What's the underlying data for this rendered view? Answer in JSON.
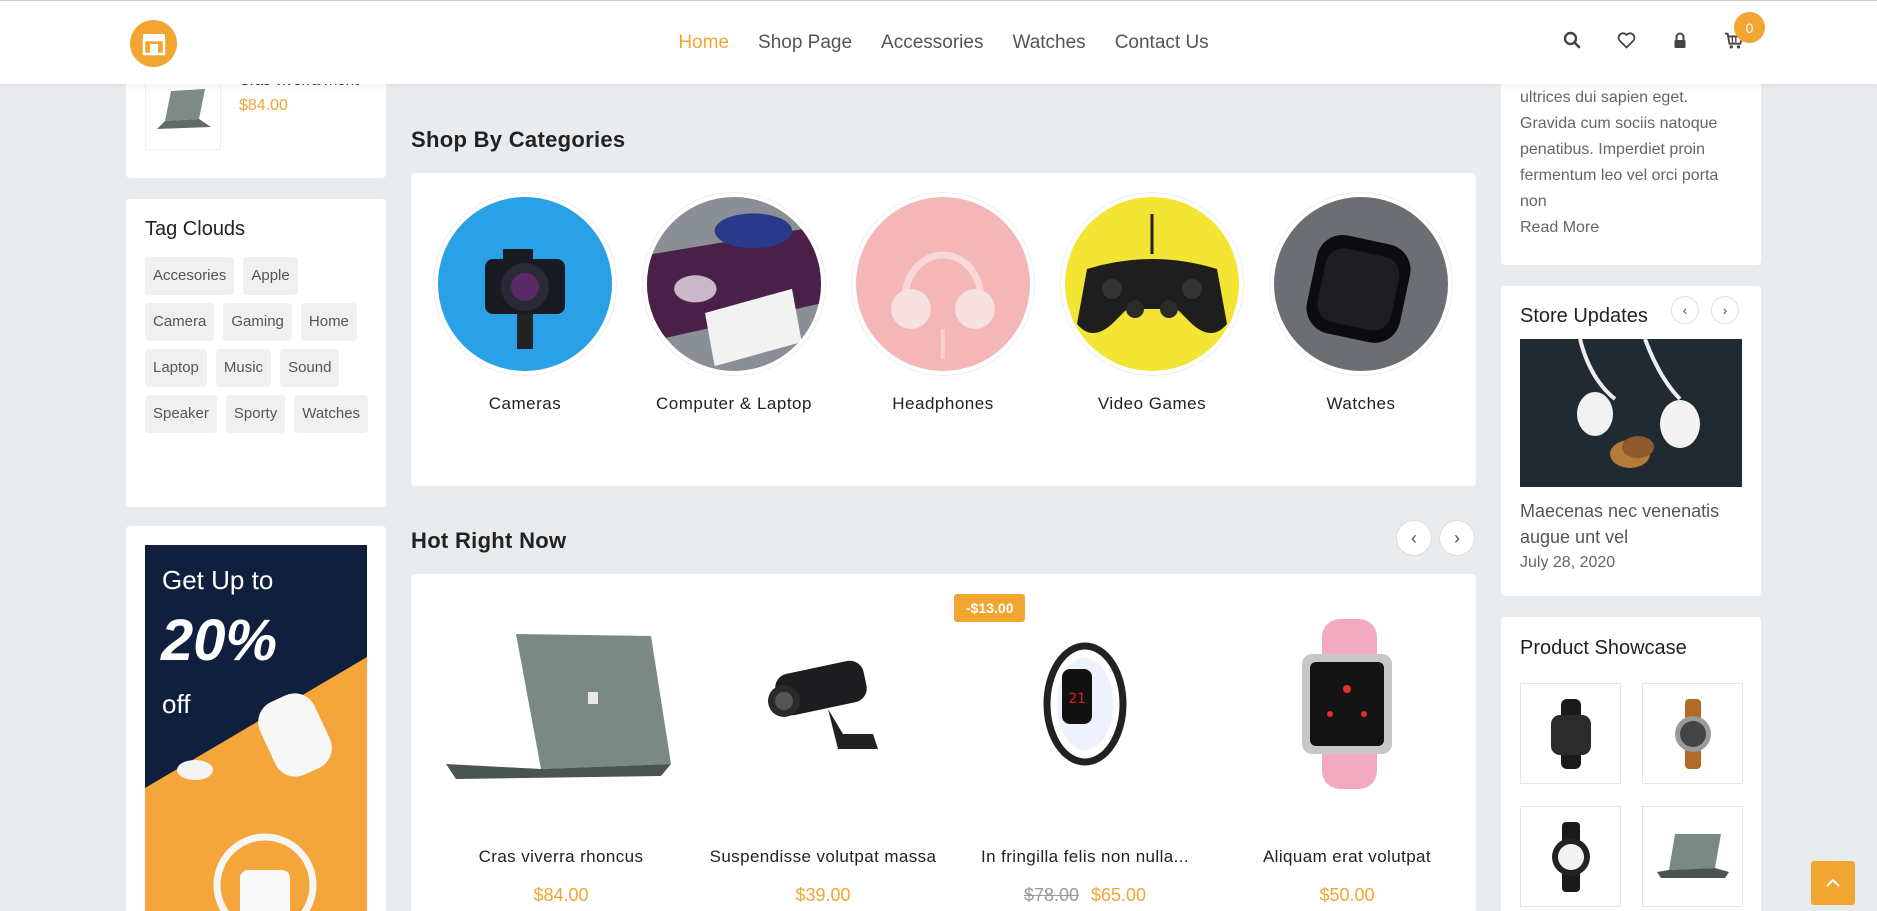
{
  "header": {
    "nav": [
      "Home",
      "Shop Page",
      "Accessories",
      "Watches",
      "Contact Us"
    ],
    "cart_count": "0"
  },
  "left": {
    "product": {
      "name": "Cras viverra rhoncus",
      "price": "$84.00"
    },
    "tags_title": "Tag Clouds",
    "tags": [
      "Accesories",
      "Apple",
      "Camera",
      "Gaming",
      "Home",
      "Laptop",
      "Music",
      "Sound",
      "Speaker",
      "Sporty",
      "Watches"
    ],
    "banner": {
      "line1": "Get Up to",
      "line2": "20%",
      "line3": "off"
    }
  },
  "categories": {
    "title": "Shop By Categories",
    "items": [
      "Cameras",
      "Computer & Laptop",
      "Headphones",
      "Video Games",
      "Watches"
    ]
  },
  "hot": {
    "title": "Hot Right Now",
    "badge": "-$13.00",
    "items": [
      {
        "name": "Cras viverra rhoncus",
        "price": "$84.00",
        "old": ""
      },
      {
        "name": "Suspendisse volutpat massa",
        "price": "$39.00",
        "old": ""
      },
      {
        "name": "In fringilla felis non nulla...",
        "price": "$65.00",
        "old": "$78.00"
      },
      {
        "name": "Aliquam erat volutpat",
        "price": "$50.00",
        "old": ""
      }
    ]
  },
  "right": {
    "about_text": "ultrices dui sapien eget. Gravida cum sociis natoque penatibus. Imperdiet proin fermentum leo vel orci porta non",
    "read_more": "Read More",
    "updates_title": "Store Updates",
    "update": {
      "title": "Maecenas nec venenatis augue unt vel",
      "date": "July 28, 2020"
    },
    "showcase_title": "Product Showcase"
  },
  "colors": {
    "accent": "#f3a532",
    "background": "#e9ecef"
  }
}
